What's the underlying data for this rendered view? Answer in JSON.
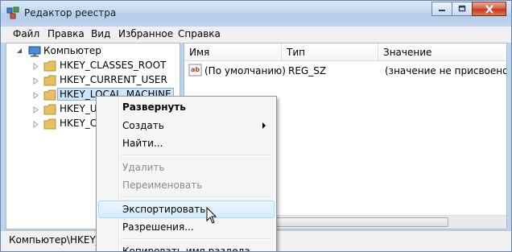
{
  "window": {
    "title": "Редактор реестра"
  },
  "menu": [
    "Файл",
    "Правка",
    "Вид",
    "Избранное",
    "Справка"
  ],
  "tree": {
    "root": "Компьютер",
    "nodes": [
      "HKEY_CLASSES_ROOT",
      "HKEY_CURRENT_USER",
      "HKEY_LOCAL_MACHINE",
      "HKEY_US",
      "HKEY_CU"
    ]
  },
  "list": {
    "headers": [
      "Имя",
      "Тип",
      "Значение"
    ],
    "rows": [
      {
        "name": "(По умолчанию)",
        "type": "REG_SZ",
        "value": "(значение не присвоено)"
      }
    ]
  },
  "statusbar": {
    "path": "Компьютер\\HKEY_L"
  },
  "context_menu": {
    "expand": "Развернуть",
    "create": "Создать",
    "find": "Найти...",
    "delete": "Удалить",
    "rename": "Переименовать",
    "export": "Экспортировать",
    "permissions": "Разрешения...",
    "copy_key": "Копировать имя раздела"
  },
  "colors": {
    "selection": "#cce5fb",
    "menu_hover": "#d6edfc",
    "folder": "#e8c064"
  }
}
